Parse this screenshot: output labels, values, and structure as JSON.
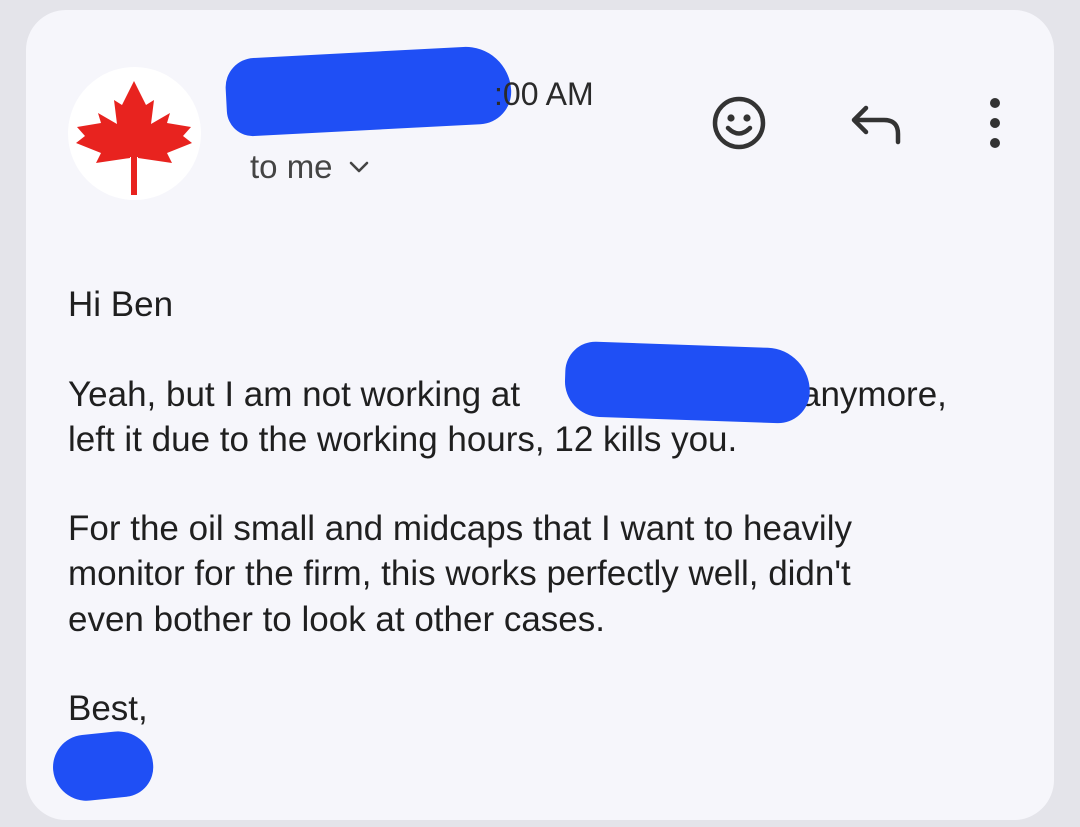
{
  "email": {
    "sender_name": "",
    "time": ":00 AM",
    "recipient": "to me",
    "greeting": "Hi Ben",
    "paragraph1": {
      "line1_before": "Yeah, but I am not working at",
      "line1_after": "anymore,",
      "line2": "left it due to the working hours, 12 kills you."
    },
    "paragraph2": [
      "For the oil small and midcaps that I want to heavily",
      "monitor for the firm, this works perfectly well, didn't",
      "even bother to look at other cases."
    ],
    "signoff": "Best,"
  },
  "icons": {
    "avatar": "canada-maple-leaf-icon",
    "recipient_toggle": "chevron-down-icon",
    "emoji": "smiley-face-icon",
    "reply": "reply-arrow-icon",
    "more": "more-vertical-icon"
  },
  "colors": {
    "background": "#f6f6fb",
    "redaction": "#1f4ff5",
    "maple_leaf": "#e8231f",
    "text": "#1f1f1f"
  }
}
